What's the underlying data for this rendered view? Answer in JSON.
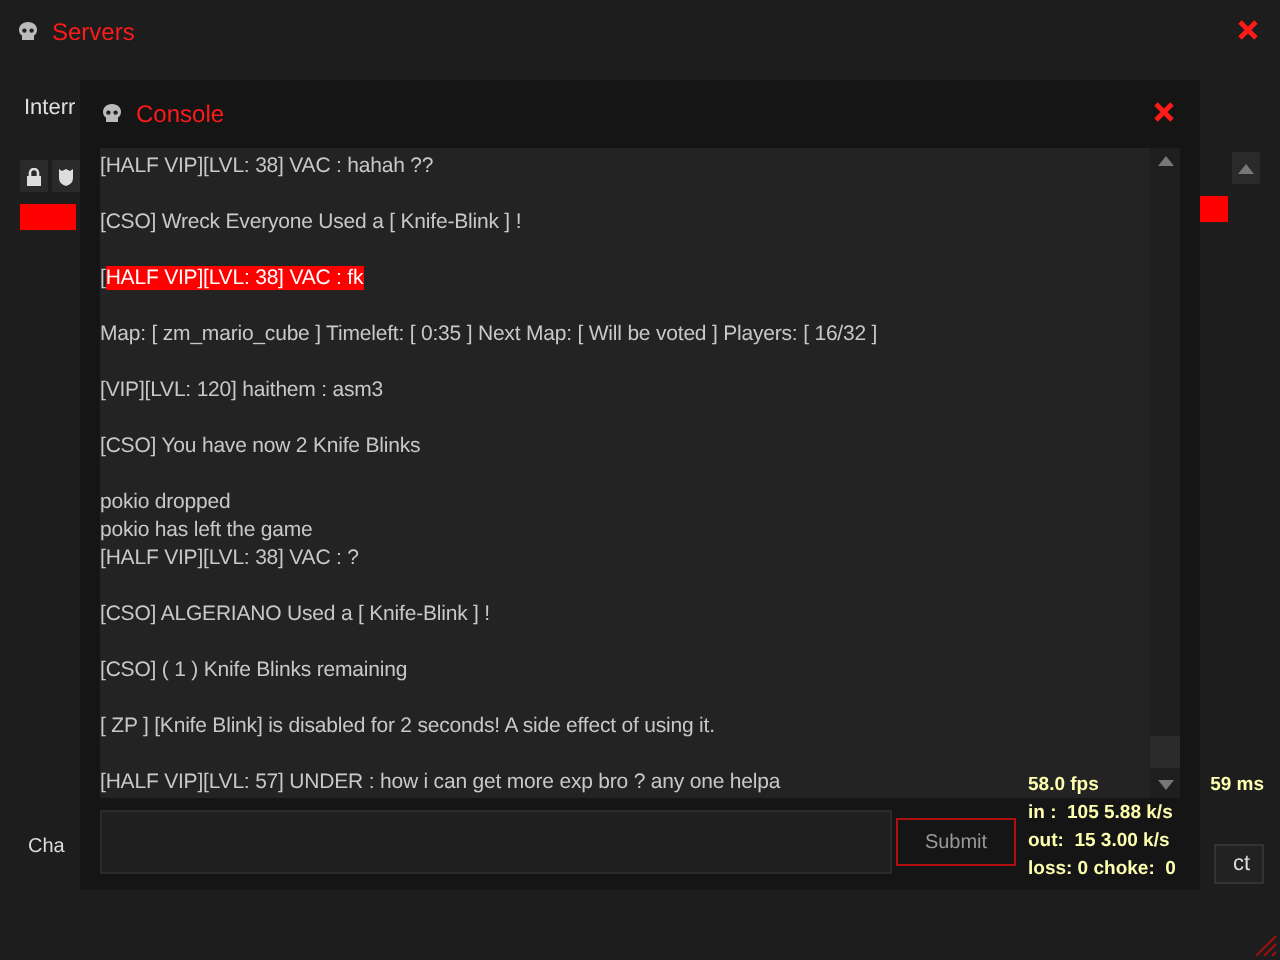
{
  "servers_window": {
    "title": "Servers",
    "tab": "Interr",
    "bottom_label": "Cha",
    "bottom_button": "ct"
  },
  "console": {
    "title": "Console",
    "messages": [
      {
        "lines": [
          {
            "text": "[HALF VIP][LVL: 38] VAC : hahah ??",
            "highlight": false
          }
        ]
      },
      {
        "lines": [
          {
            "text": "[CSO] Wreck Everyone Used a [ Knife-Blink ] !",
            "highlight": false
          }
        ]
      },
      {
        "lines": [
          {
            "lead": "[",
            "text": "HALF VIP][LVL: 38] VAC : fk",
            "highlight": true
          }
        ]
      },
      {
        "lines": [
          {
            "text": "Map: [ zm_mario_cube ] Timeleft: [ 0:35 ] Next Map: [ Will be voted ] Players: [ 16/32 ]",
            "highlight": false
          }
        ]
      },
      {
        "lines": [
          {
            "text": "[VIP][LVL: 120] haithem : asm3",
            "highlight": false
          }
        ]
      },
      {
        "lines": [
          {
            "text": "[CSO] You have now 2 Knife Blinks",
            "highlight": false
          }
        ]
      },
      {
        "lines": [
          {
            "text": "pokio dropped",
            "highlight": false
          },
          {
            "text": "pokio has left the game",
            "highlight": false
          },
          {
            "text": "[HALF VIP][LVL: 38] VAC : ?",
            "highlight": false
          }
        ]
      },
      {
        "lines": [
          {
            "text": "[CSO] ALGERIANO Used a [ Knife-Blink ] !",
            "highlight": false
          }
        ]
      },
      {
        "lines": [
          {
            "text": "[CSO] ( 1 ) Knife Blinks remaining",
            "highlight": false
          }
        ]
      },
      {
        "lines": [
          {
            "text": "[ ZP ] [Knife Blink] is disabled for 2 seconds! A side effect of using it.",
            "highlight": false
          }
        ]
      },
      {
        "lines": [
          {
            "text": "[HALF VIP][LVL: 57] UNDER : how i can get more exp bro ? any one helpa",
            "highlight": false
          }
        ]
      }
    ],
    "submit": "Submit"
  },
  "net_graph": {
    "fps": "58.0 fps",
    "ping": "59 ms",
    "in": "in :  105 5.88 k/s",
    "out": "out:  15 3.00 k/s",
    "loss": "loss: 0 choke:  0"
  }
}
